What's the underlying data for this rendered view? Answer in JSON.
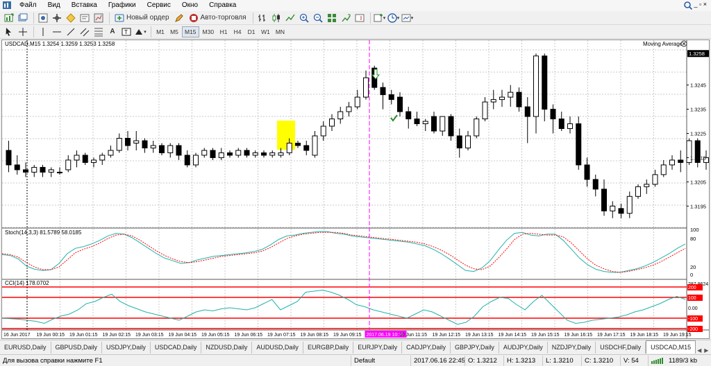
{
  "menu": [
    "Файл",
    "Вид",
    "Вставка",
    "Графики",
    "Сервис",
    "Окно",
    "Справка"
  ],
  "toolbar": {
    "new_order_label": "Новый ордер",
    "autotrading_label": "Авто-торговля",
    "timeframes": [
      "M1",
      "M5",
      "M15",
      "M30",
      "H1",
      "H4",
      "D1",
      "W1",
      "MN"
    ],
    "active_timeframe": "M15"
  },
  "chart": {
    "symbol_info": "USDCAD,M15  1.3254 1.3259 1.3253 1.3258",
    "indicator_label": "Moving Average",
    "price_labels": [
      "1.3258",
      "1.3245",
      "1.3235",
      "1.3225",
      "1.3215",
      "1.3205",
      "1.3195"
    ],
    "time_labels": [
      "16 Jun 2017",
      "19 Jun 00:15",
      "19 Jun 01:15",
      "19 Jun 02:15",
      "19 Jun 03:15",
      "19 Jun 04:15",
      "19 Jun 05:15",
      "19 Jun 06:15",
      "19 Jun 07:15",
      "19 Jun 08:15",
      "19 Jun 09:15",
      "2017.06.19 10:15",
      "19 Jun 11:15",
      "19 Jun 12:15",
      "19 Jun 13:15",
      "19 Jun 14:15",
      "19 Jun 15:15",
      "19 Jun 16:15",
      "19 Jun 17:15",
      "19 Jun 18:15",
      "19 Jun 19:15"
    ],
    "current_price": "1.3258",
    "stoch_label": "Stoch(14,3,3) 81.5789 58.0185",
    "stoch_levels": [
      "100",
      "80",
      "20",
      "0"
    ],
    "cci_label": "CCI(14) 178.0702",
    "cci_levels": [
      "287.9624",
      "200",
      "100",
      "0.00",
      "-100",
      "-200",
      "-199"
    ],
    "colors": {
      "up_candle": "#ffffff",
      "down_candle": "#000000",
      "crosshair": "#ff00ff",
      "stoch_main": "#20b2aa",
      "stoch_signal": "#ff0000",
      "cci": "#20b2aa",
      "cci_levels": "#ff0000",
      "highlight": "#ffff00",
      "arrow": "#2e8b2e"
    }
  },
  "tabs": [
    "EURUSD,Daily",
    "GBPUSD,Daily",
    "USDJPY,Daily",
    "USDCAD,Daily",
    "NZDUSD,Daily",
    "AUDUSD,Daily",
    "EURGBP,Daily",
    "EURJPY,Daily",
    "CADJPY,Daily",
    "GBPJPY,Daily",
    "AUDJPY,Daily",
    "NZDJPY,Daily",
    "USDCHF,Daily",
    "USDCAD,M15"
  ],
  "status": {
    "help": "Для вызова справки нажмите F1",
    "profile": "Default",
    "datetime": "2017.06.16 22:45",
    "open": "O: 1.3212",
    "high": "H: 1.3213",
    "low": "L: 1.3210",
    "close": "C: 1.3210",
    "volume": "V: 54",
    "traffic": "1189/3 kb"
  }
}
